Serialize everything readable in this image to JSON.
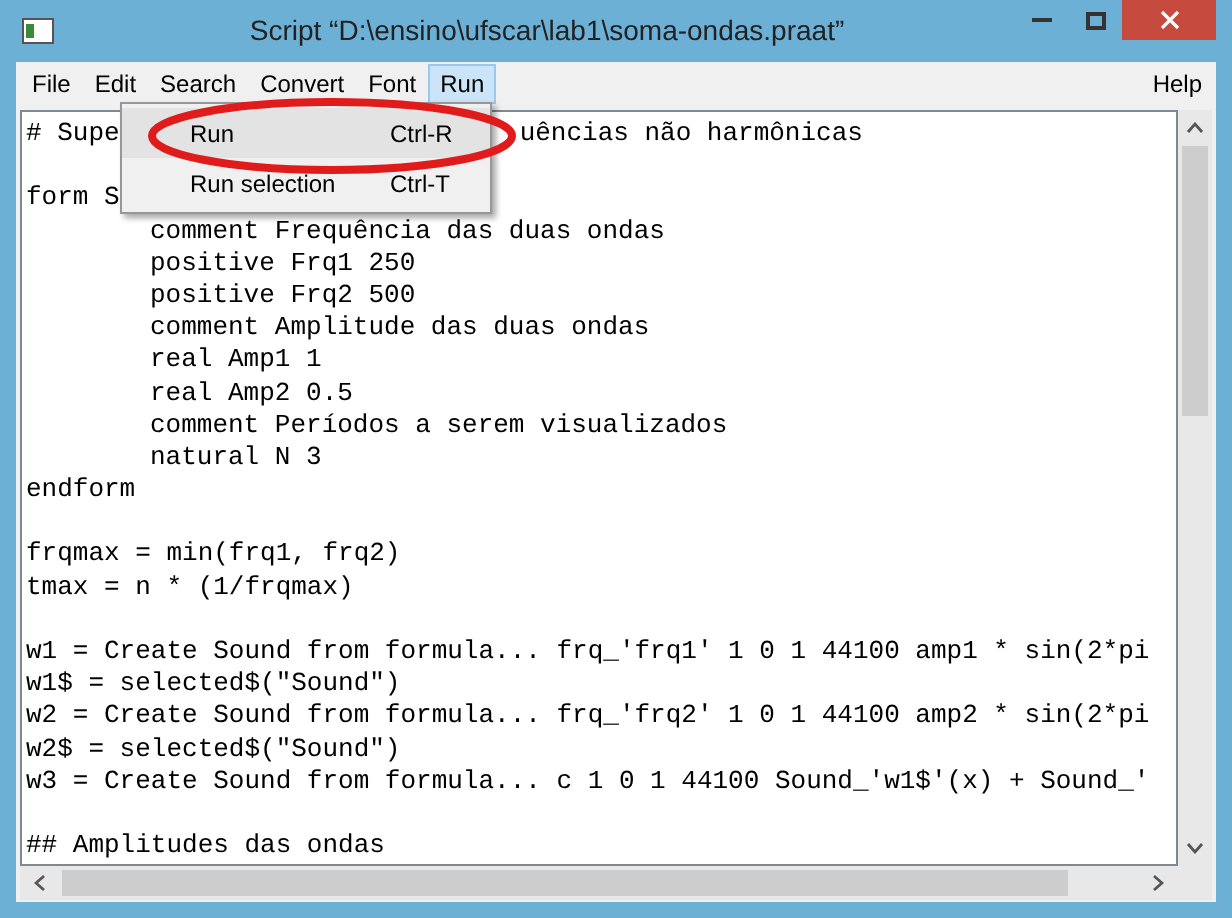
{
  "window": {
    "title": "Script “D:\\ensino\\ufscar\\lab1\\soma-ondas.praat”"
  },
  "menu_bar": {
    "items": [
      {
        "label": "File",
        "selected": false
      },
      {
        "label": "Edit",
        "selected": false
      },
      {
        "label": "Search",
        "selected": false
      },
      {
        "label": "Convert",
        "selected": false
      },
      {
        "label": "Font",
        "selected": false
      },
      {
        "label": "Run",
        "selected": true
      }
    ],
    "help": "Help"
  },
  "open_menu": {
    "items": [
      {
        "label": "Run",
        "shortcut": "Ctrl-R",
        "highlighted": true
      },
      {
        "label": "Run selection",
        "shortcut": "Ctrl-T",
        "highlighted": false
      }
    ]
  },
  "editor": {
    "blocks": [
      {
        "lines": [
          {
            "segments": [
              "# Supe",
              "uências não harmônicas"
            ]
          }
        ]
      },
      {
        "lines": [
          {
            "segments": [
              "form S"
            ],
            "children": [
              {
                "segments": [
                  "comment Frequência das duas ondas"
                ]
              },
              {
                "segments": [
                  "positive Frq1 250"
                ]
              },
              {
                "segments": [
                  "positive Frq2 500"
                ]
              },
              {
                "segments": [
                  "comment Amplitude das duas ondas"
                ]
              },
              {
                "segments": [
                  "real Amp1 1"
                ]
              },
              {
                "segments": [
                  "real Amp2 0.5"
                ]
              },
              {
                "segments": [
                  "comment Períodos a serem visualizados"
                ]
              },
              {
                "segments": [
                  "natural N 3"
                ]
              }
            ]
          },
          {
            "segments": [
              "endform"
            ]
          }
        ]
      },
      {
        "lines": [
          {
            "segments": [
              "frqmax = min(frq1, frq2)"
            ]
          },
          {
            "segments": [
              "tmax = n * (1/frqmax)"
            ]
          }
        ]
      },
      {
        "lines": [
          {
            "segments": [
              "w1 = Create Sound from formula... frq_'frq1' 1 0 1 44100 amp1 * sin(2*pi"
            ]
          },
          {
            "segments": [
              "w1$ = selected$(\"Sound\")"
            ]
          },
          {
            "segments": [
              "w2 = Create Sound from formula... frq_'frq2' 1 0 1 44100 amp2 * sin(2*pi"
            ]
          },
          {
            "segments": [
              "w2$ = selected$(\"Sound\")"
            ]
          },
          {
            "segments": [
              "w3 = Create Sound from formula... c 1 0 1 44100 Sound_'w1$'(x) + Sound_'"
            ]
          }
        ]
      },
      {
        "lines": [
          {
            "segments": [
              "## Amplitudes das ondas"
            ]
          }
        ]
      }
    ]
  }
}
